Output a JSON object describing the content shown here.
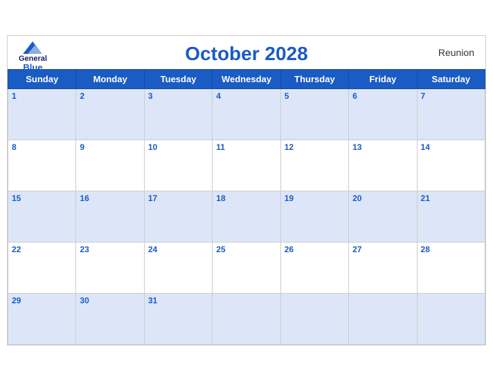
{
  "header": {
    "logo_general": "General",
    "logo_blue": "Blue",
    "title": "October 2028",
    "region": "Reunion"
  },
  "weekdays": [
    "Sunday",
    "Monday",
    "Tuesday",
    "Wednesday",
    "Thursday",
    "Friday",
    "Saturday"
  ],
  "weeks": [
    [
      1,
      2,
      3,
      4,
      5,
      6,
      7
    ],
    [
      8,
      9,
      10,
      11,
      12,
      13,
      14
    ],
    [
      15,
      16,
      17,
      18,
      19,
      20,
      21
    ],
    [
      22,
      23,
      24,
      25,
      26,
      27,
      28
    ],
    [
      29,
      30,
      31,
      null,
      null,
      null,
      null
    ]
  ]
}
